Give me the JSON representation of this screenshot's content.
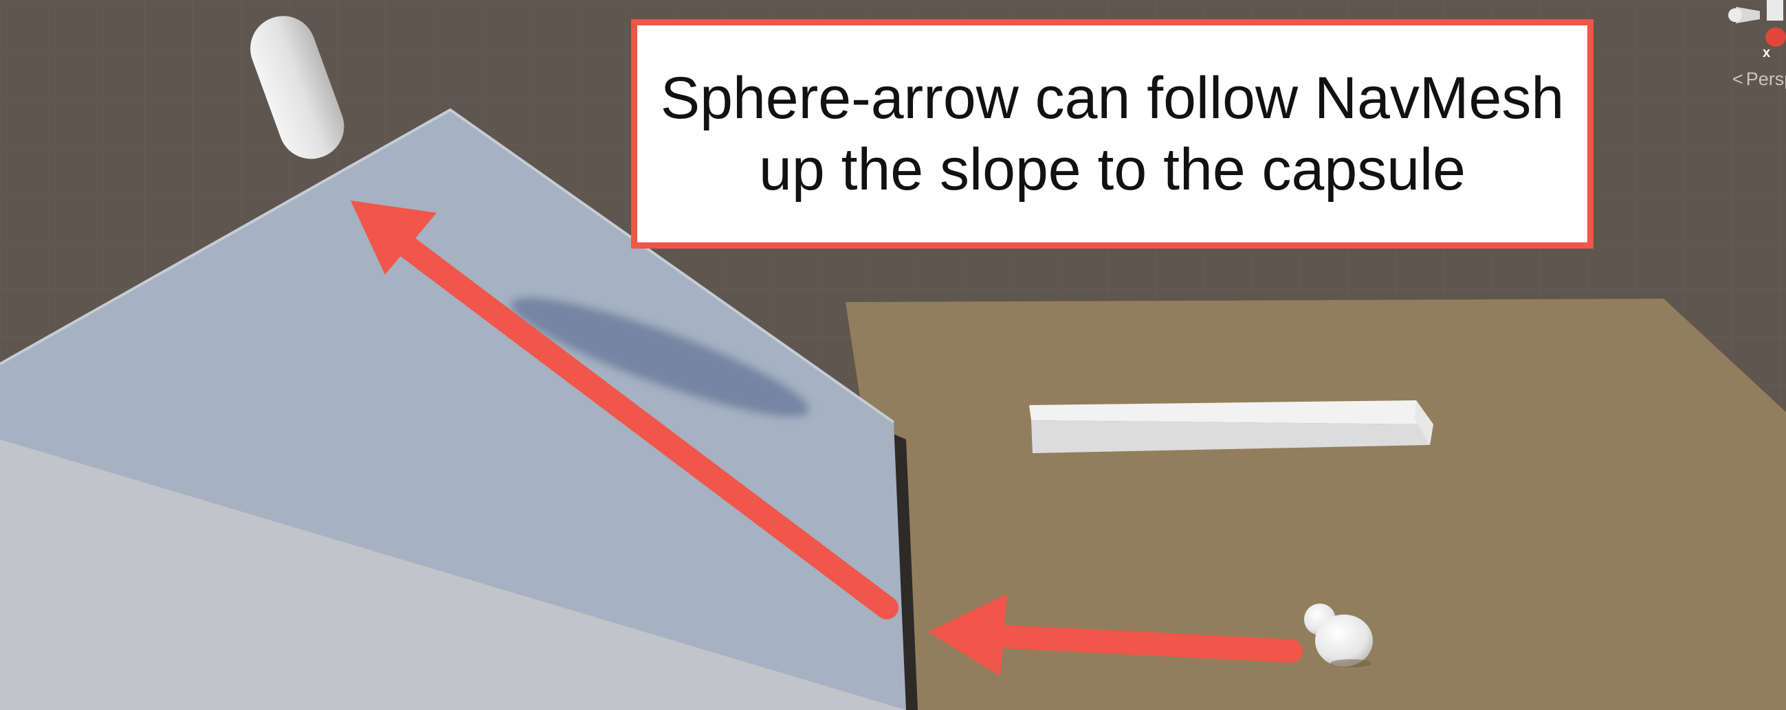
{
  "callout": {
    "line1": "Sphere-arrow can follow NavMesh",
    "line2": "up the slope to the capsule",
    "border_color": "#ee5647"
  },
  "scene_gizmo": {
    "axis_label": "x",
    "projection_label": "Persp",
    "projection_icon": "chevron-left-icon",
    "x_axis_color": "#e0463a"
  },
  "scene": {
    "background_color": "#5f564f",
    "ramp_color": "#a9b3c2",
    "ground_color": "#8f7a58",
    "arrow_color": "#f0564a"
  }
}
